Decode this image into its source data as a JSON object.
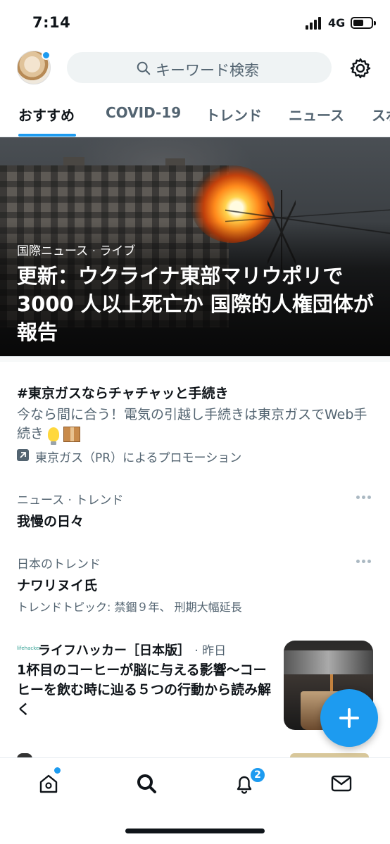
{
  "status_bar": {
    "time": "7:14",
    "network": "4G"
  },
  "header": {
    "search_placeholder": "キーワード検索"
  },
  "tabs": [
    {
      "label": "おすすめ",
      "active": true
    },
    {
      "label": "COVID-19",
      "active": false
    },
    {
      "label": "トレンド",
      "active": false
    },
    {
      "label": "ニュース",
      "active": false
    },
    {
      "label": "スポ",
      "active": false
    }
  ],
  "hero": {
    "category": "国際ニュース",
    "separator": "·",
    "status": "ライブ",
    "headline": "更新：ウクライナ東部マリウポリで 3000 人以上死亡か 国際的人権団体が報告"
  },
  "promo": {
    "title": "#東京ガスならチャチャッと手続き",
    "body": "今なら間に合う！電気の引越し手続きは東京ガスでWeb手続き",
    "sponsor": "東京ガス（PR）によるプロモーション"
  },
  "trends": [
    {
      "category": "ニュース · トレンド",
      "title": "我慢の日々",
      "subtitle": ""
    },
    {
      "category": "日本のトレンド",
      "title": "ナワリヌイ氏",
      "subtitle": "トレンドトピック: 禁錮９年、 刑期大幅延長"
    }
  ],
  "news_card": {
    "logo_text": "lifehacker",
    "source": "ライフハッカー［日本版］",
    "time": "· 昨日",
    "headline": "1杯目のコーヒーが脳に与える影響〜コーヒーを飲む時に辿る５つの行動から読み解く"
  },
  "bottom_nav": {
    "notification_count": "2",
    "items": [
      "home-icon",
      "search-icon",
      "bell-icon",
      "mail-icon"
    ]
  },
  "colors": {
    "accent": "#1d9bf0",
    "secondary_text": "#536471",
    "primary_text": "#0f1419"
  }
}
